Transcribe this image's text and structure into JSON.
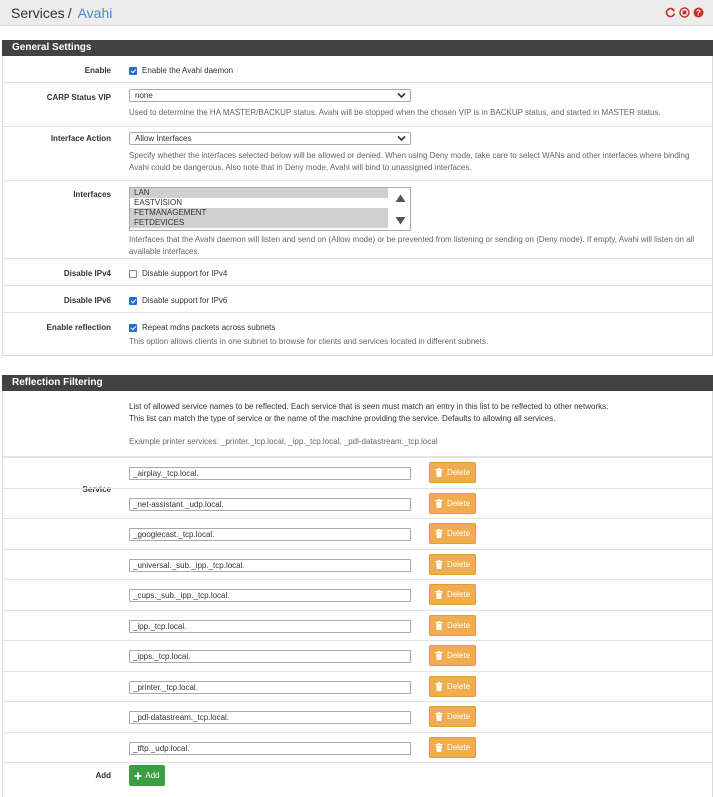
{
  "breadcrumb": {
    "root": "Services",
    "separator": "/",
    "current": "Avahi"
  },
  "header_icons": [
    "reload-icon",
    "stop-icon",
    "help-icon"
  ],
  "colors": {
    "panel_header": "#424242",
    "link": "#4a89c8",
    "delete_button": "#f0ad4e",
    "add_button": "#3c9e42",
    "checkbox": "#1f6fcf"
  },
  "general": {
    "title": "General Settings",
    "enable": {
      "label": "Enable",
      "checkbox": "Enable the Avahi daemon",
      "checked": true
    },
    "carp": {
      "label": "CARP Status VIP",
      "value": "none",
      "help": "Used to determine the HA MASTER/BACKUP status. Avahi will be stopped when the chosen VIP is in BACKUP status, and started in MASTER status."
    },
    "iface_action": {
      "label": "Interface Action",
      "value": "Allow Interfaces",
      "help": "Specify whether the interfaces selected below will be allowed or denied. When using Deny mode, take care to select WANs and other interfaces where binding Avahi could be dangerous. Also note that in Deny mode, Avahi will bind to unassigned interfaces."
    },
    "interfaces": {
      "label": "Interfaces",
      "options": [
        "LAN",
        "EASTVISION",
        "FETMANAGEMENT",
        "FETDEVICES"
      ],
      "selected": [
        true,
        false,
        true,
        true
      ],
      "help": "Interfaces that the Avahi daemon will listen and send on (Allow mode) or be prevented from listening or sending on (Deny mode). If empty, Avahi will listen on all available interfaces."
    },
    "ipv4": {
      "label": "Disable IPv4",
      "checkbox": "Disable support for IPv4",
      "checked": false
    },
    "ipv6": {
      "label": "Disable IPv6",
      "checkbox": "Disable support for IPv6",
      "checked": true
    },
    "reflection": {
      "label": "Enable reflection",
      "checkbox": "Repeat mdns packets across subnets",
      "checked": true,
      "help": "This option allows clients in one subnet to browse for clients and services located in different subnets."
    }
  },
  "filtering": {
    "title": "Reflection Filtering",
    "desc1": "List of allowed service names to be reflected. Each service that is seen must match an entry in this list to be reflected to other networks.",
    "desc2": "This list can match the type of service or the name of the machine providing the service. Defaults to allowing all services.",
    "example": "Example printer services: _printer._tcp.local, _ipp._tcp.local, _pdl-datastream._tcp.local",
    "service_label": "Service",
    "delete_label": "Delete",
    "services": [
      "_airplay._tcp.local.",
      "_net-assistant._udp.local.",
      "_googlecast._tcp.local.",
      "_universal._sub._ipp._tcp.local.",
      "_cups._sub._ipp._tcp.local.",
      "_ipp._tcp.local.",
      "_ipps._tcp.local.",
      "_printer._tcp.local.",
      "_pdl-datastream._tcp.local.",
      "_tftp._udp.local."
    ],
    "add_label": "Add",
    "add_button": "Add"
  }
}
